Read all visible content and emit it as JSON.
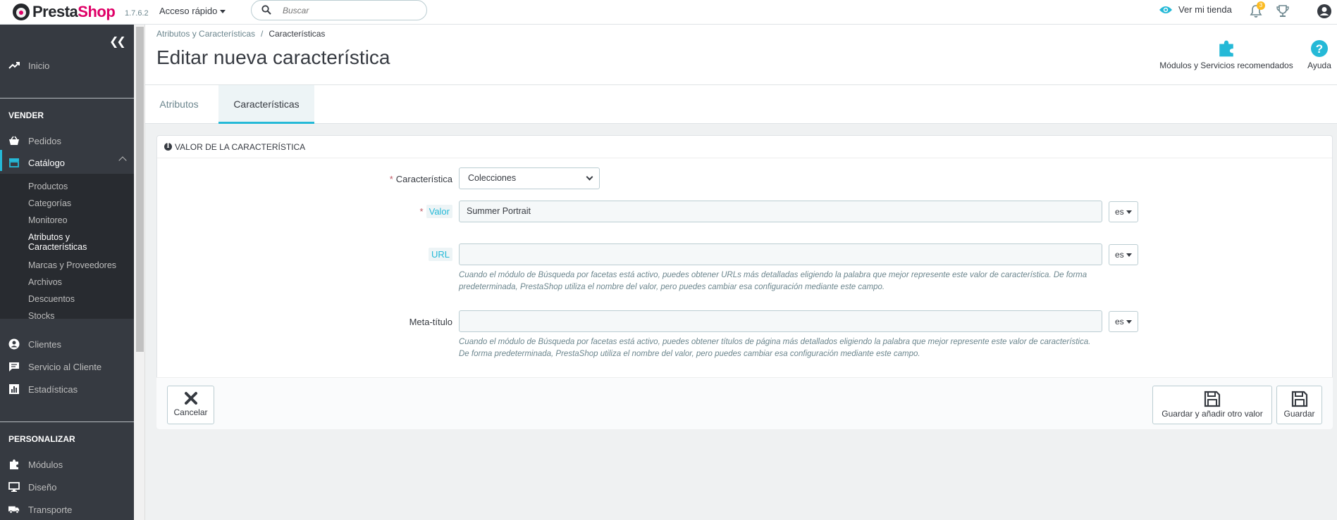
{
  "header": {
    "brand_part1": "Presta",
    "brand_part2": "Shop",
    "version": "1.7.6.2",
    "quick_access": "Acceso rápido",
    "search_placeholder": "Buscar",
    "view_store": "Ver mi tienda",
    "notifications_count": "3"
  },
  "sidebar": {
    "home": "Inicio",
    "section_sell": "VENDER",
    "orders": "Pedidos",
    "catalog": "Catálogo",
    "catalog_items": [
      "Productos",
      "Categorías",
      "Monitoreo",
      "Atributos y Características",
      "Marcas y Proveedores",
      "Archivos",
      "Descuentos",
      "Stocks"
    ],
    "customers": "Clientes",
    "customer_service": "Servicio al Cliente",
    "stats": "Estadísticas",
    "section_customize": "PERSONALIZAR",
    "modules": "Módulos",
    "design": "Diseño",
    "shipping": "Transporte"
  },
  "page": {
    "breadcrumb_parent": "Atributos y Características",
    "breadcrumb_current": "Características",
    "title": "Editar nueva característica",
    "modules_services": "Módulos y Servicios recomendados",
    "help": "Ayuda",
    "tabs": [
      "Atributos",
      "Características"
    ]
  },
  "form": {
    "panel_title": "Valor de la característica",
    "feature_label": "Característica",
    "feature_value": "Colecciones",
    "value_label": "Valor",
    "value_value": "Summer Portrait",
    "url_label": "URL",
    "url_value": "",
    "url_help": "Cuando el módulo de Búsqueda por facetas está activo, puedes obtener URLs más detalladas eligiendo la palabra que mejor represente este valor de característica. De forma predeterminada, PrestaShop utiliza el nombre del valor, pero puedes cambiar esa configuración mediante este campo.",
    "meta_label": "Meta-título",
    "meta_value": "",
    "meta_help": "Cuando el módulo de Búsqueda por facetas está activo, puedes obtener títulos de página más detallados eligiendo la palabra que mejor represente este valor de característica. De forma predeterminada, PrestaShop utiliza el nombre del valor, pero puedes cambiar esa configuración mediante este campo.",
    "lang": "es",
    "cancel": "Cancelar",
    "save_add": "Guardar y añadir otro valor",
    "save": "Guardar"
  },
  "colors": {
    "accent": "#25b9d7",
    "brand_pink": "#df0067",
    "sidebar_bg": "#363a41",
    "required": "#c05c67"
  }
}
